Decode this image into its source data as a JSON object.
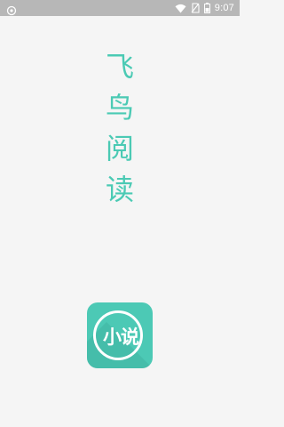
{
  "status_bar": {
    "time": "9:07",
    "icons": [
      "notification-icon",
      "wifi-icon",
      "no-sim-icon",
      "battery-icon"
    ]
  },
  "splash": {
    "title_chars": [
      "飞",
      "鸟",
      "阅",
      "读"
    ],
    "app_icon_label": "小说"
  },
  "colors": {
    "status_bar": "#b7b7b7",
    "background": "#f5f5f5",
    "accent": "#4bcab4",
    "icon_bg": "#4cc9b5"
  }
}
